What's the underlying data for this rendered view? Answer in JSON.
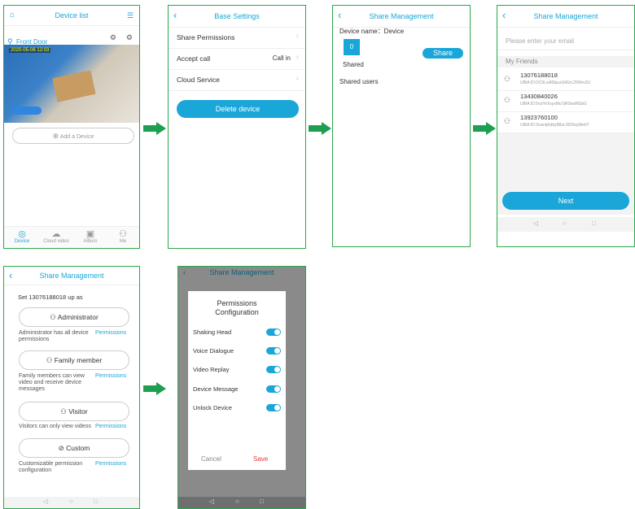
{
  "screen1": {
    "title": "Device list",
    "device_name": "Front Door",
    "timestamp": "2020-05-06  12:03",
    "add_device": "Add a Device",
    "tabs": [
      "Device",
      "Cloud video",
      "Album",
      "Me"
    ]
  },
  "screen2": {
    "title": "Base Settings",
    "rows": [
      {
        "label": "Share Permissions",
        "value": ""
      },
      {
        "label": "Accept call",
        "value": "Call in"
      },
      {
        "label": "Cloud Service",
        "value": ""
      }
    ],
    "delete_button": "Delete device"
  },
  "screen3": {
    "title": "Share Management",
    "device_label": "Device name：Device",
    "shared_count": "0",
    "shared_label": "Shared",
    "share_button": "Share",
    "shared_users": "Shared users"
  },
  "screen4": {
    "title": "Share Management",
    "email_placeholder": "Please enter your email",
    "friends_header": "My Friends",
    "friends": [
      {
        "phone": "13076188018",
        "uid": "UBIA ID:DC5LwM0puzG66zL25Wrv3U"
      },
      {
        "phone": "13430840026",
        "uid": "UBIA ID:5nzYeXsyxMuTjRDwdNSbG"
      },
      {
        "phone": "13923760100",
        "uid": "UBIA ID:3cwmjEdkyB8xL9lO0syWebT"
      }
    ],
    "next_button": "Next"
  },
  "screen5": {
    "title": "Share Management",
    "setup_text": "Set 13076188018 up as",
    "roles": [
      {
        "label": "Administrator",
        "icon": "admin-user-icon",
        "desc": "Administrator has all device permissions",
        "perm": "Permissions"
      },
      {
        "label": "Family member",
        "icon": "family-user-icon",
        "desc": "Family members can view video and receive device messages",
        "perm": "Permissions"
      },
      {
        "label": "Visitor",
        "icon": "visitor-user-icon",
        "desc": "Visitors can only view videos",
        "perm": "Permissions"
      },
      {
        "label": "Custom",
        "icon": "custom-circle-icon",
        "desc": "Customizable permission configuration",
        "perm": "Permissions"
      }
    ]
  },
  "screen6": {
    "bg_title": "Share Management",
    "dialog_title": "Permissions Configuration",
    "permissions": [
      "Shaking Head",
      "Voice Dialogue",
      "Video Replay",
      "Device Message",
      "Unlock Device"
    ],
    "cancel": "Cancel",
    "save": "Save"
  },
  "colors": {
    "accent": "#1aa6d8",
    "frame": "#2aa84a",
    "save": "#e53935"
  }
}
